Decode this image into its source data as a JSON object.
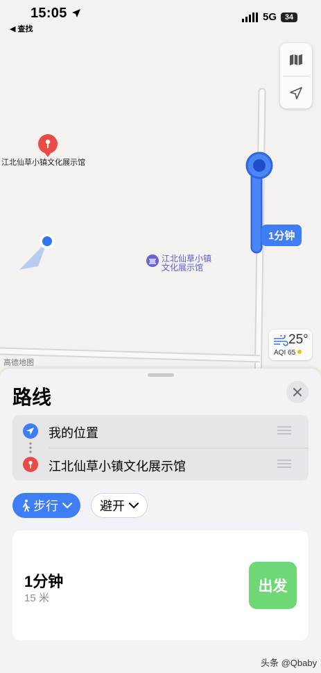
{
  "status_bar": {
    "time": "15:05",
    "back_label": "◀ 查找",
    "network": "5G",
    "battery": "34"
  },
  "map": {
    "poi_label": "江北仙草小镇文化展示馆",
    "center_poi_line1": "江北仙草小镇",
    "center_poi_line2": "文化展示馆",
    "route_time_label": "1分钟",
    "weather_temp": "25°",
    "weather_aqi": "AQI 65",
    "brand": "高德地图"
  },
  "sheet": {
    "title": "路线",
    "waypoints": [
      {
        "label": "我的位置",
        "icon": "location-arrow-icon"
      },
      {
        "label": "江北仙草小镇文化展示馆",
        "icon": "pin-icon"
      }
    ],
    "mode_chip": "步行",
    "avoid_chip": "避开",
    "route": {
      "duration": "1分钟",
      "distance": "15 米"
    },
    "go_button": "出发"
  },
  "watermark": "头条 @Qbaby",
  "colors": {
    "accent": "#3f7df4",
    "go": "#6dd875",
    "pin": "#ea4c45"
  }
}
